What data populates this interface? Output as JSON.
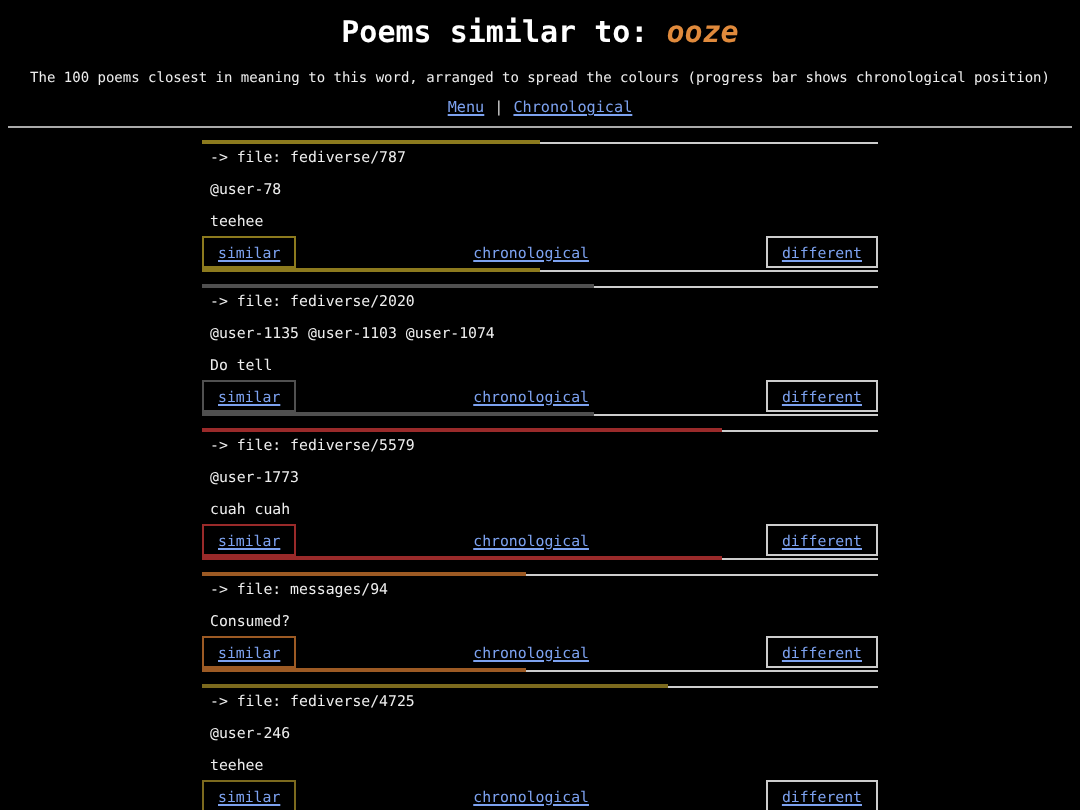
{
  "header": {
    "title": "Poems similar to:",
    "word": "ooze",
    "subtitle": "The 100 poems closest in meaning to this word, arranged to spread the colours (progress bar shows chronological position)",
    "links": [
      "Menu",
      "Chronological"
    ],
    "separator": "|"
  },
  "poems": [
    {
      "file": "-> file: fediverse/787",
      "lines": [
        "@user-78",
        "teehee"
      ],
      "color": "#8c7a1e",
      "level": 0.5,
      "buttons": {
        "similar": "similar",
        "chronological": "chronological",
        "different": "different"
      }
    },
    {
      "file": "-> file: fediverse/2020",
      "lines": [
        "@user-1135 @user-1103 @user-1074",
        "Do tell"
      ],
      "color": "#505050",
      "level": 0.58,
      "buttons": {
        "similar": "similar",
        "chronological": "chronological",
        "different": "different"
      }
    },
    {
      "file": "-> file: fediverse/5579",
      "lines": [
        "@user-1773",
        "cuah cuah"
      ],
      "color": "#9a2a2a",
      "level": 0.77,
      "buttons": {
        "similar": "similar",
        "chronological": "chronological",
        "different": "different"
      }
    },
    {
      "file": "-> file: messages/94",
      "lines": [
        "Consumed?"
      ],
      "color": "#9c5a24",
      "level": 0.48,
      "buttons": {
        "similar": "similar",
        "chronological": "chronological",
        "different": "different"
      }
    },
    {
      "file": "-> file: fediverse/4725",
      "lines": [
        "@user-246",
        "teehee"
      ],
      "color": "#7c6a1e",
      "level": 0.69,
      "buttons": {
        "similar": "similar",
        "chronological": "chronological",
        "different": "different"
      }
    }
  ]
}
